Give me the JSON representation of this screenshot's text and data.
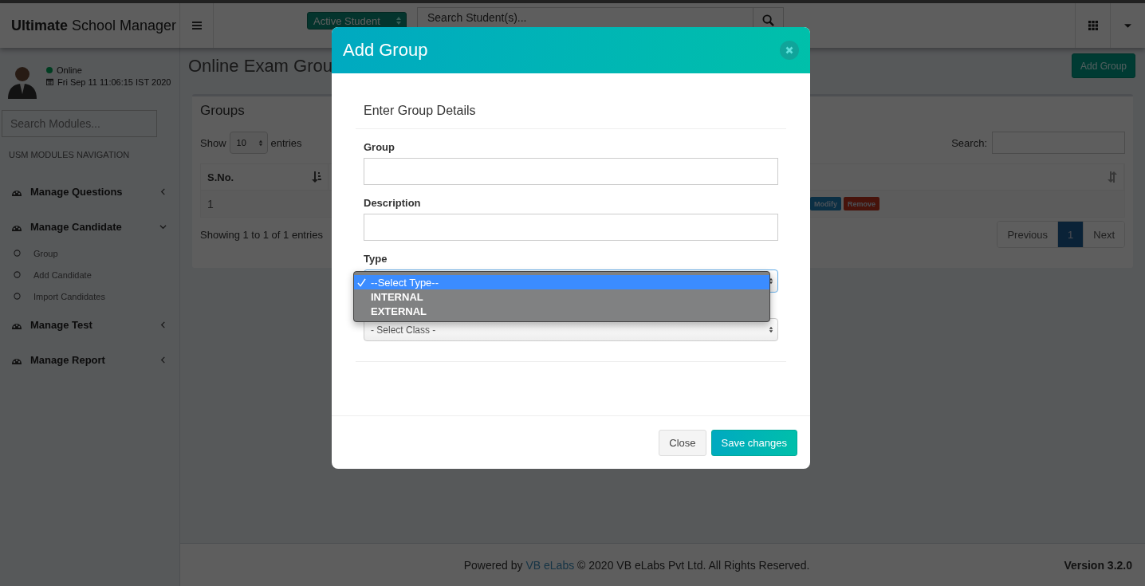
{
  "header": {
    "logo": "**Ultimate** School Manager",
    "student_filter": {
      "value": "Active Student"
    },
    "search": {
      "placeholder": "Search Student(s)..."
    }
  },
  "user": {
    "status": "Online",
    "online": true,
    "datetime": "Fri Sep 11 11:06:15 IST 2020"
  },
  "sidebar": {
    "search": {
      "placeholder": "Search Modules..."
    },
    "heading": "USM MODULES NAVIGATION",
    "items": [
      {
        "label": "Manage Questions",
        "expanded": false
      },
      {
        "label": "Manage Candidate",
        "expanded": true,
        "children": [
          {
            "label": "Group"
          },
          {
            "label": "Add Candidate"
          },
          {
            "label": "Import Candidates"
          }
        ]
      },
      {
        "label": "Manage Test",
        "expanded": false
      },
      {
        "label": "Manage Report",
        "expanded": false
      }
    ]
  },
  "page": {
    "title": "Online Exam Grou",
    "add_button": "Add Group"
  },
  "card": {
    "title": "Groups",
    "length": {
      "before": "Show",
      "value": "10",
      "after": "entries"
    },
    "search_label": "Search:",
    "columns": [
      "S.No."
    ],
    "rows": [
      {
        "cells": [
          "1"
        ],
        "actions": [
          {
            "label": "Modify",
            "kind": "primary"
          },
          {
            "label": "Remove",
            "kind": "danger"
          }
        ]
      }
    ],
    "info": "Showing 1 to 1 of 1 entries",
    "pagination": [
      {
        "label": "Previous",
        "selected": false
      },
      {
        "label": "1",
        "selected": true
      },
      {
        "label": "Next",
        "selected": false
      }
    ]
  },
  "modal": {
    "title": "Add Group",
    "section_title": "Enter Group Details",
    "fields": [
      {
        "kind": "text",
        "label": "Group"
      },
      {
        "kind": "text",
        "label": "Description"
      },
      {
        "kind": "select",
        "label": "Type",
        "open": true,
        "options": [
          {
            "label": "--Select Type--",
            "selected": true
          },
          {
            "label": "INTERNAL",
            "selected": false
          },
          {
            "label": "EXTERNAL",
            "selected": false
          }
        ]
      },
      {
        "kind": "select",
        "value": "- Select Class -"
      }
    ],
    "buttons": [
      {
        "label": "Close",
        "kind": "default"
      },
      {
        "label": "Save changes",
        "kind": "primary"
      }
    ]
  },
  "footer": {
    "before": "Powered by",
    "link": "VB eLabs",
    "after": "© 2020 VB eLabs Pvt Ltd. All Rights Reserved.",
    "version": "Version 3.2.0"
  }
}
